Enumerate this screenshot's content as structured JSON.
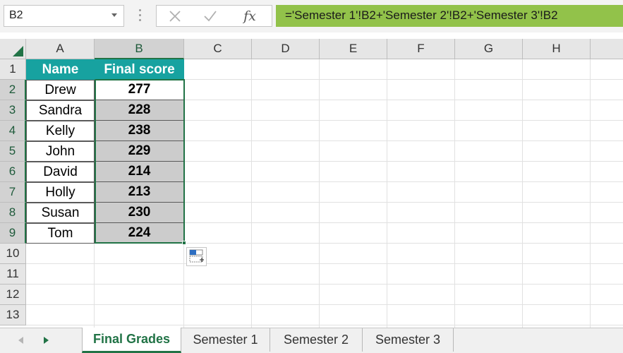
{
  "name_box": {
    "value": "B2"
  },
  "formula_bar": {
    "cancel_icon": "close-icon",
    "enter_icon": "check-icon",
    "insert_function_label": "fx",
    "formula": "='Semester 1'!B2+'Semester 2'!B2+'Semester 3'!B2"
  },
  "columns": [
    "A",
    "B",
    "C",
    "D",
    "E",
    "F",
    "G",
    "H"
  ],
  "selected_column": "B",
  "rows": [
    "1",
    "2",
    "3",
    "4",
    "5",
    "6",
    "7",
    "8",
    "9",
    "10",
    "11",
    "12",
    "13"
  ],
  "table": {
    "headers": {
      "name": "Name",
      "score": "Final score"
    },
    "records": [
      {
        "name": "Drew",
        "score": "277"
      },
      {
        "name": "Sandra",
        "score": "228"
      },
      {
        "name": "Kelly",
        "score": "238"
      },
      {
        "name": "John",
        "score": "229"
      },
      {
        "name": "David",
        "score": "214"
      },
      {
        "name": "Holly",
        "score": "213"
      },
      {
        "name": "Susan",
        "score": "230"
      },
      {
        "name": "Tom",
        "score": "224"
      }
    ]
  },
  "active_cell": "B2",
  "selection_range": "B2:B9",
  "sheet_tabs": [
    {
      "label": "Final Grades",
      "active": true
    },
    {
      "label": "Semester 1",
      "active": false
    },
    {
      "label": "Semester 2",
      "active": false
    },
    {
      "label": "Semester 3",
      "active": false
    }
  ],
  "colors": {
    "accent": "#217346",
    "header_fill": "#17a2a0",
    "formula_highlight": "#92c24a",
    "selection_fill": "#cccccc"
  }
}
